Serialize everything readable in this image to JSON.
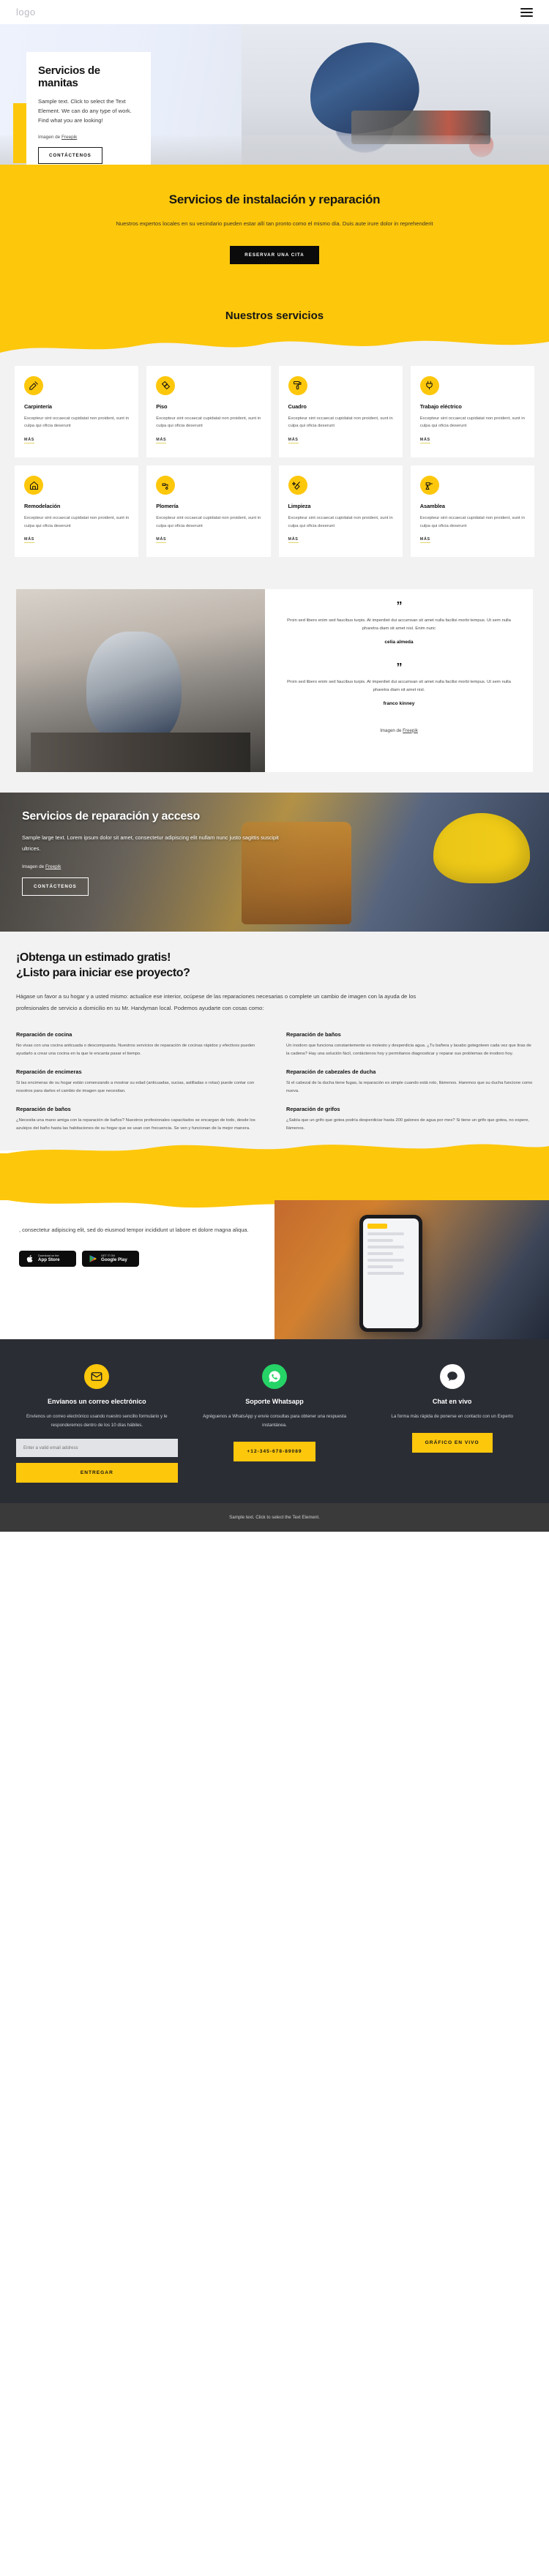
{
  "header": {
    "logo": "logo",
    "menu_icon": "hamburger-menu-icon"
  },
  "hero": {
    "title": "Servicios de manitas",
    "subtitle": "Sample text. Click to select the Text Element. We can do any type of work. Find what you are looking!",
    "credit_prefix": "Imagen de ",
    "credit_link": "Freepik",
    "cta": "CONTÁCTENOS"
  },
  "banner": {
    "title": "Servicios de instalación y reparación",
    "text": "Nuestros expertos locales en su vecindario pueden estar allí tan pronto como el mismo día. Duis aute irure dolor in reprehenderit",
    "cta": "RESERVAR UNA CITA"
  },
  "services": {
    "title": "Nuestros servicios",
    "more_label": "MÁS",
    "body": "Excepteur sint occaecat cupidatat non proident, sunt in culpa qui oficia deserunt",
    "items": [
      {
        "name": "Carpintería",
        "icon": "saw-tools-icon"
      },
      {
        "name": "Piso",
        "icon": "flooring-tiles-icon"
      },
      {
        "name": "Cuadro",
        "icon": "paint-roller-icon"
      },
      {
        "name": "Trabajo eléctrico",
        "icon": "electric-plug-icon"
      },
      {
        "name": "Remodelación",
        "icon": "house-remodel-icon"
      },
      {
        "name": "Plomería",
        "icon": "faucet-drip-icon"
      },
      {
        "name": "Limpieza",
        "icon": "broom-sparkle-icon"
      },
      {
        "name": "Asamblea",
        "icon": "assembly-drill-icon"
      }
    ]
  },
  "testimonials": {
    "caption_prefix": "Imagen de ",
    "caption_link": "Freepik",
    "items": [
      {
        "quote_mark": "”",
        "text": "Proin sed libero enim sed faucibus turpis. At imperdiet dui accumsan sit amet nulla facilisi morbi tempus. Ut sem nulla pharetra diam sit amet nisl. Enim nunc",
        "author": "celia almeda"
      },
      {
        "quote_mark": "”",
        "text": "Proin sed libero enim sed faucibus turpis. At imperdiet dui accumsan sit amet nulla facilisi morbi tempus. Ut sem nulla pharetra diam sit amet nisl.",
        "author": "franco kinney"
      }
    ]
  },
  "photo_banner": {
    "title": "Servicios de reparación y acceso",
    "text": "Sample large text. Lorem ipsum dolor sit amet, consectetur adipiscing elit nullam nunc justo sagittis suscipit ultrices.",
    "credit_prefix": "Imagen de ",
    "credit_link": "Freepik",
    "cta": "CONTÁCTENOS"
  },
  "estimate": {
    "title_line1": "¡Obtenga un estimado gratis!",
    "title_line2": "¿Listo para iniciar ese proyecto?",
    "lead": "Hágase un favor a su hogar y a usted mismo: actualice ese interior, ocúpese de las reparaciones necesarias o complete un cambio de imagen con la ayuda de los profesionales de servicio a domicilio en su Mr. Handyman local. Podemos ayudarte con cosas como:",
    "blocks": [
      {
        "heading": "Reparación de cocina",
        "body": "No vivas con una cocina anticuada o descompuesta. Nuestros servicios de reparación de cocinas rápidos y efectivos pueden ayudarlo a crear una cocina en la que le encanta pasar el tiempo."
      },
      {
        "heading": "Reparación de baños",
        "body": "Un inodoro que funciona constantemente es molesto y desperdicia agua. ¿Tu bañera y lavabo gotegoteen cada vez que tiras de la cadena? Hay una solución fácil, contáctenos hoy y permítanos diagnosticar y reparar sus problemas de inodoro hoy."
      },
      {
        "heading": "Reparación de encimeras",
        "body": "Si las encimeras de su hogar están comenzando a mostrar su edad (anticuadas, sucias, astilladas o rotas) puede contar con nosotros para darles el cambio de imagen que necesitan."
      },
      {
        "heading": "Reparación de cabezales de ducha",
        "body": "Si el cabezal de la ducha tiene fugas, la reparación es simple cuando está roto, llámenos. Haremos que su ducha funcione como nueva."
      },
      {
        "heading": "Reparación de baños",
        "body": "¿Necesita una mano amiga con la reparación de baños? Nuestros profesionales capacitados se encargan de todo, desde los azulejos del baño hasta las habitaciones de su hogar que se usan con frecuencia. Se ven y funcionan de la mejor manera."
      },
      {
        "heading": "Reparación de grifos",
        "body": "¿Sabía que un grifo que gotea podría desperdiciar hasta 200 galones de agua por mes? Si tiene un grifo que gotea, no espere, llámenos."
      }
    ]
  },
  "app": {
    "text": ", consectetur adipiscing elit, sed do eiusmod tempor incididunt ut labore et dolore magna aliqua.",
    "stores": [
      {
        "icon": "apple-icon",
        "small": "Download on the",
        "big": "App Store"
      },
      {
        "icon": "google-play-icon",
        "small": "GET IT ON",
        "big": "Google Play"
      }
    ]
  },
  "footer": {
    "columns": [
      {
        "icon": "envelope-icon",
        "icon_color": "#fdc70c",
        "title": "Envíanos un correo electrónico",
        "text": "Envíenos un correo electrónico usando nuestro sencillo formulario y le responderemos dentro de los 10 días hábiles.",
        "input_placeholder": "Enter a valid email address",
        "input_value": "",
        "button": "ENTREGAR"
      },
      {
        "icon": "whatsapp-icon",
        "icon_color": "#25d366",
        "title": "Soporte Whatsapp",
        "text": "Agréguenos a WhatsApp y envíe consultas para obtener una respuesta instantánea.",
        "button": "+12-345-678-89089"
      },
      {
        "icon": "chat-bubble-icon",
        "icon_color": "#ffffff",
        "title": "Chat en vivo",
        "text": "La forma más rápida de ponerse en contacto con un Experto",
        "button": "GRÁFICO EN VIVO"
      }
    ],
    "bottom": "Sample text. Click to select the Text Element."
  }
}
